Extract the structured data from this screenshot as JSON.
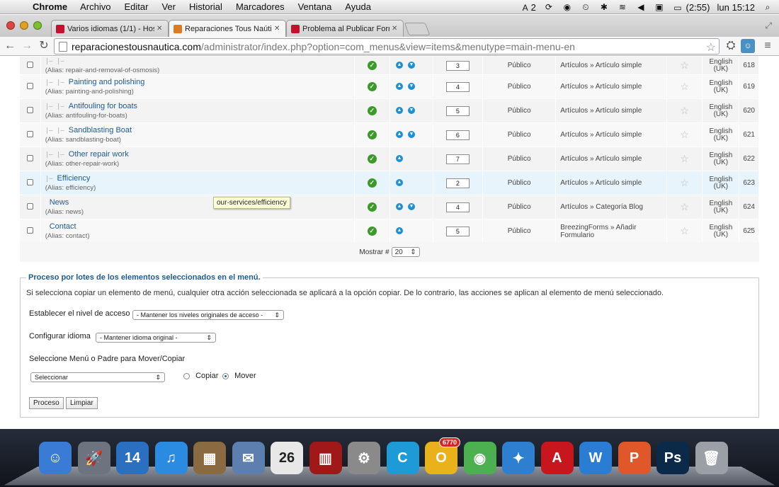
{
  "mac_menubar": {
    "app_name": "Chrome",
    "menus": [
      "Archivo",
      "Editar",
      "Ver",
      "Historial",
      "Marcadores",
      "Ventana",
      "Ayuda"
    ],
    "status": {
      "adobe_count": "2",
      "battery": "(2:55)",
      "clock": "lun 15:12"
    }
  },
  "browser": {
    "tabs": [
      {
        "title": "Varios idiomas (1/1) - Hos",
        "favicon_color": "#c8102e",
        "active": false
      },
      {
        "title": "Reparaciones Tous Naútica",
        "favicon_color": "#e07a1f",
        "active": true
      },
      {
        "title": "Problema al Publicar Form",
        "favicon_color": "#c8102e",
        "active": false
      }
    ],
    "url_host": "reparacionestousnautica.com",
    "url_path": "/administrator/index.php?option=com_menus&view=items&menutype=main-menu-en"
  },
  "table": {
    "rows": [
      {
        "indent": "|— |—",
        "title": "",
        "alias": "(Alias: repair-and-removal-of-osmosis)",
        "order": "3",
        "arrows": 2,
        "access": "Público",
        "type": "Artículos » Artículo simple",
        "lang": "English (UK)",
        "id": "618"
      },
      {
        "indent": "|— |—",
        "title": "Painting and polishing",
        "alias": "(Alias: painting-and-polishing)",
        "order": "4",
        "arrows": 2,
        "access": "Público",
        "type": "Artículos » Artículo simple",
        "lang": "English (UK)",
        "id": "619"
      },
      {
        "indent": "|— |—",
        "title": "Antifouling for boats",
        "alias": "(Alias: antifouling-for-boats)",
        "order": "5",
        "arrows": 2,
        "access": "Público",
        "type": "Artículos » Artículo simple",
        "lang": "English (UK)",
        "id": "620"
      },
      {
        "indent": "|— |—",
        "title": "Sandblasting Boat",
        "alias": "(Alias: sandblasting-boat)",
        "order": "6",
        "arrows": 2,
        "access": "Público",
        "type": "Artículos » Artículo simple",
        "lang": "English (UK)",
        "id": "621"
      },
      {
        "indent": "|— |—",
        "title": "Other repair work",
        "alias": "(Alias: other-repair-work)",
        "order": "7",
        "arrows": 1,
        "access": "Público",
        "type": "Artículos » Artículo simple",
        "lang": "English (UK)",
        "id": "622"
      },
      {
        "indent": "|—",
        "title": "Efficiency",
        "alias": "(Alias: efficiency)",
        "order": "2",
        "arrows": 1,
        "access": "Público",
        "type": "Artículos » Artículo simple",
        "lang": "English (UK)",
        "id": "623"
      },
      {
        "indent": "",
        "title": "News",
        "alias": "(Alias: news)",
        "order": "4",
        "arrows": 2,
        "access": "Público",
        "type": "Artículos » Categoría Blog",
        "lang": "English (UK)",
        "id": "624"
      },
      {
        "indent": "",
        "title": "Contact",
        "alias": "(Alias: contact)",
        "order": "5",
        "arrows": 1,
        "access": "Público",
        "type": "BreezingForms » Añadir Formulario",
        "lang": "English (UK)",
        "id": "625"
      }
    ],
    "tooltip": "our-services/efficiency"
  },
  "pagination": {
    "label": "Mostrar #",
    "value": "20"
  },
  "batch": {
    "legend": "Proceso por lotes de los elementos seleccionados en el menú.",
    "description": "Si selecciona copiar un elemento de menú, cualquier otra acción seleccionada se aplicará a la opción copiar. De lo contrario, las acciones se aplican al elemento de menú seleccionado.",
    "access_label": "Establecer el nivel de acceso",
    "access_value": "- Mantener los niveles originales de acceso -",
    "language_label": "Configurar idioma",
    "language_value": "- Mantener idioma original -",
    "move_label": "Seleccione Menú o Padre para Mover/Copiar",
    "move_value": "Seleccionar",
    "copy_label": "Copiar",
    "move_radio_label": "Mover",
    "process_button": "Proceso",
    "clear_button": "Limpiar"
  },
  "dock": {
    "icons": [
      {
        "name": "finder",
        "color": "#3a7bd5",
        "glyph": "☺"
      },
      {
        "name": "launchpad",
        "color": "#6d7480",
        "glyph": "🚀"
      },
      {
        "name": "clock",
        "color": "#2a6fc0",
        "glyph": "14"
      },
      {
        "name": "itunes",
        "color": "#2b8be0",
        "glyph": "♫"
      },
      {
        "name": "photos",
        "color": "#8a6a40",
        "glyph": "▦"
      },
      {
        "name": "preview",
        "color": "#5c7fb0",
        "glyph": "✉"
      },
      {
        "name": "calendar",
        "color": "#e8e8e8",
        "glyph": "26"
      },
      {
        "name": "photobooth",
        "color": "#a01818",
        "glyph": "▥"
      },
      {
        "name": "system-preferences",
        "color": "#8a8a8a",
        "glyph": "⚙"
      },
      {
        "name": "app-c",
        "color": "#1e9ad6",
        "glyph": "C"
      },
      {
        "name": "app-o",
        "color": "#e9b21a",
        "glyph": "O",
        "badge": "6770"
      },
      {
        "name": "chrome",
        "color": "#4caf50",
        "glyph": "◉"
      },
      {
        "name": "network",
        "color": "#2f7fd0",
        "glyph": "✦"
      },
      {
        "name": "acrobat",
        "color": "#c8161e",
        "glyph": "A"
      },
      {
        "name": "word",
        "color": "#2b7cd3",
        "glyph": "W"
      },
      {
        "name": "powerpoint",
        "color": "#e0572a",
        "glyph": "P"
      },
      {
        "name": "photoshop",
        "color": "#0b2a4a",
        "glyph": "Ps"
      },
      {
        "name": "trash",
        "color": "#9aa0a6",
        "glyph": "🗑"
      }
    ]
  }
}
